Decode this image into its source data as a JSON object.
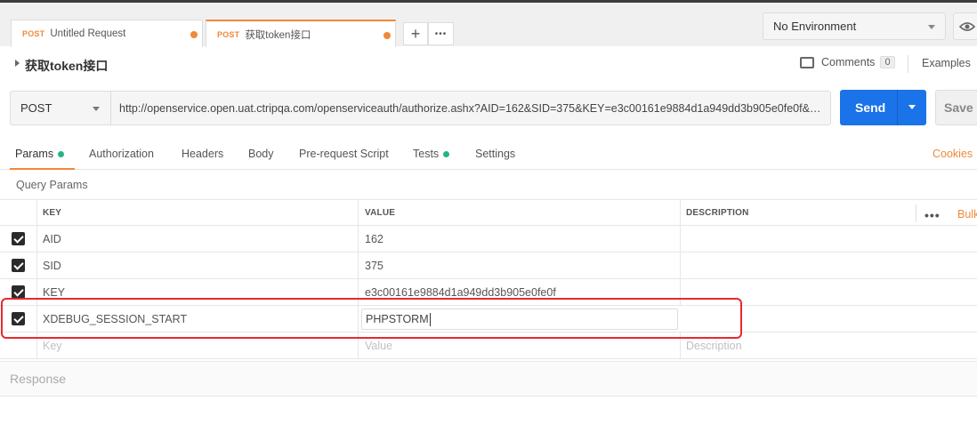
{
  "tabs": [
    {
      "method": "POST",
      "label": "Untitled Request"
    },
    {
      "method": "POST",
      "label": "获取token接口"
    }
  ],
  "tab_actions": {
    "add": "+",
    "more": "•••"
  },
  "environment": {
    "selected": "No Environment"
  },
  "request": {
    "name": "获取token接口",
    "comments_label": "Comments",
    "comments_count": "0",
    "examples_label": "Examples",
    "method": "POST",
    "url": "http://openservice.open.uat.ctripqa.com/openserviceauth/authorize.ashx?AID=162&SID=375&KEY=e3c00161e9884d1a949dd3b905e0fe0f&XD...",
    "send_label": "Send",
    "save_label": "Save"
  },
  "subtabs": [
    "Params",
    "Authorization",
    "Headers",
    "Body",
    "Pre-request Script",
    "Tests",
    "Settings"
  ],
  "cookies_label": "Cookies",
  "query_params": {
    "label": "Query Params",
    "headers": {
      "key": "KEY",
      "value": "VALUE",
      "description": "DESCRIPTION"
    },
    "more": "•••",
    "bulk_edit": "Bulk",
    "rows": [
      {
        "key": "AID",
        "value": "162",
        "description": ""
      },
      {
        "key": "SID",
        "value": "375",
        "description": ""
      },
      {
        "key": "KEY",
        "value": "e3c00161e9884d1a949dd3b905e0fe0f",
        "description": ""
      },
      {
        "key": "XDEBUG_SESSION_START",
        "value": "PHPSTORM",
        "description": ""
      }
    ],
    "placeholders": {
      "key": "Key",
      "value": "Value",
      "description": "Description"
    }
  },
  "response_label": "Response",
  "colors": {
    "accent": "#f0883a",
    "send": "#1a73e8",
    "active_dot": "#26b47f",
    "highlight": "#e8282d"
  }
}
